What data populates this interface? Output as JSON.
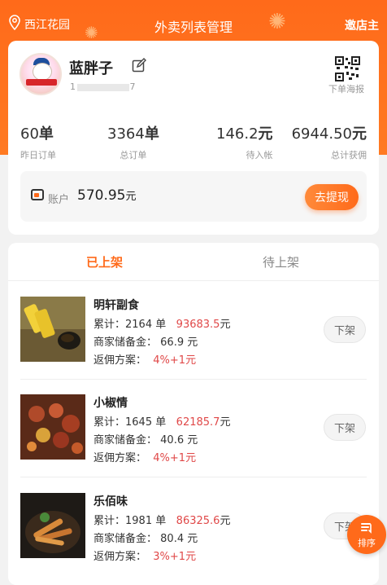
{
  "header": {
    "location": "西江花园",
    "title": "外卖列表管理",
    "invite": "邀店主"
  },
  "profile": {
    "name": "蓝胖子",
    "phone_start": "1",
    "phone_end": "7",
    "poster_label": "下单海报"
  },
  "stats": [
    {
      "value": "60",
      "unit": "单",
      "label": "昨日订单"
    },
    {
      "value": "3364",
      "unit": "单",
      "label": "总订单"
    },
    {
      "value": "146.2",
      "unit": "元",
      "label": "待入帐"
    },
    {
      "value": "6944.50",
      "unit": "元",
      "label": "总计获佣"
    }
  ],
  "account": {
    "label": "账户",
    "amount": "570.95",
    "unit": "元",
    "withdraw_label": "去提现"
  },
  "tabs": {
    "listed": "已上架",
    "pending": "待上架"
  },
  "items": [
    {
      "name": "明轩副食",
      "total_label": "累计：",
      "orders": "2164",
      "orders_unit": "单",
      "amount": "93683.5",
      "amount_unit": "元",
      "deposit_label": "商家储备金：",
      "deposit": "66.9",
      "deposit_unit": "元",
      "plan_label": "返佣方案：",
      "plan": "4%+1元",
      "button": "下架"
    },
    {
      "name": "小椒情",
      "total_label": "累计：",
      "orders": "1645",
      "orders_unit": "单",
      "amount": "62185.7",
      "amount_unit": "元",
      "deposit_label": "商家储备金：",
      "deposit": "40.6",
      "deposit_unit": "元",
      "plan_label": "返佣方案：",
      "plan": "4%+1元",
      "button": "下架"
    },
    {
      "name": "乐佰味",
      "total_label": "累计：",
      "orders": "1981",
      "orders_unit": "单",
      "amount": "86325.6",
      "amount_unit": "元",
      "deposit_label": "商家储备金：",
      "deposit": "80.4",
      "deposit_unit": "元",
      "plan_label": "返佣方案：",
      "plan": "3%+1元",
      "button": "下架"
    }
  ],
  "sort_button": "排序",
  "colors": {
    "accent": "#ff6a1a",
    "highlight": "#e04848"
  },
  "icons": [
    "location-pin-icon",
    "edit-icon",
    "qr-code-icon",
    "wallet-icon",
    "sort-icon"
  ]
}
